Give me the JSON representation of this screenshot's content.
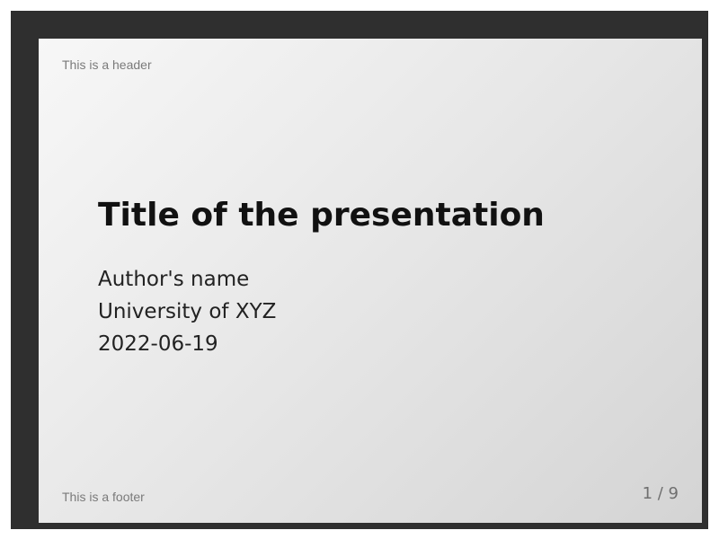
{
  "slide": {
    "header": "This is a header",
    "title": "Title of the presentation",
    "author": "Author's name",
    "institution": "University of XYZ",
    "date": "2022-06-19",
    "footer": "This is a footer",
    "page_number": "1 / 9"
  }
}
